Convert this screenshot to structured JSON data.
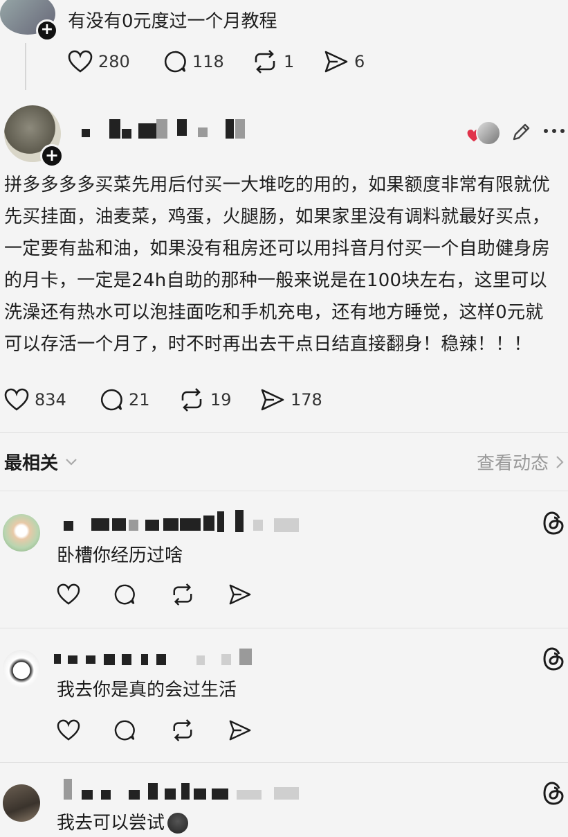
{
  "prev_post": {
    "text": "有没有0元度过一个月教程",
    "likes": "280",
    "comments": "118",
    "reposts": "1",
    "shares": "6"
  },
  "main_post": {
    "text": "拼多多多多买菜先用后付买一大堆吃的用的，如果额度非常有限就优先买挂面，油麦菜，鸡蛋，火腿肠，如果家里没有调料就最好买点，一定要有盐和油，如果没有租房还可以用抖音月付买一个自助健身房的月卡，一定是24h自助的那种一般来说是在100块左右，这里可以洗澡还有热水可以泡挂面吃和手机充电，还有地方睡觉，这样0元就可以存活一个月了，时不时再出去干点日结直接翻身！稳辣！！！",
    "likes": "834",
    "comments": "21",
    "reposts": "19",
    "shares": "178"
  },
  "sort_bar": {
    "label": "最相关",
    "view_activity": "查看动态"
  },
  "comments": [
    {
      "text": "卧槽你经历过啥"
    },
    {
      "text": "我去你是真的会过生活"
    },
    {
      "text": "我去可以尝试"
    }
  ],
  "colors": {
    "heart_red": "#e0324a",
    "icon": "#1b1b1b",
    "muted": "#9a9a9a"
  }
}
